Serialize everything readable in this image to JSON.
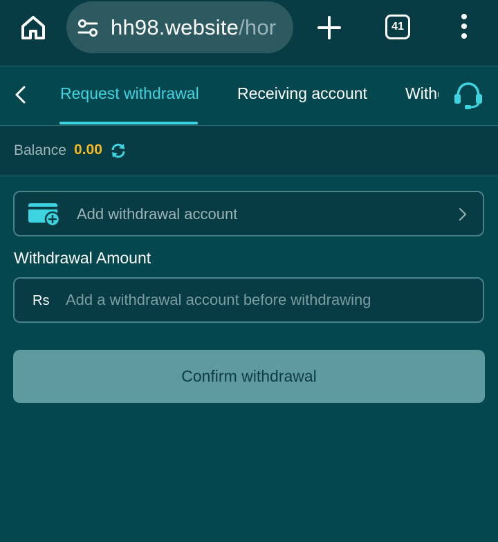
{
  "browser": {
    "url_host": "hh98.website",
    "url_path": "/hor",
    "tab_count": "41"
  },
  "tabs": [
    {
      "label": "Request withdrawal",
      "active": true
    },
    {
      "label": "Receiving account",
      "active": false
    },
    {
      "label": "Withdrawal",
      "active": false
    }
  ],
  "balance": {
    "label": "Balance",
    "value": "0.00"
  },
  "add_account": {
    "label": "Add withdrawal account"
  },
  "amount": {
    "heading": "Withdrawal Amount",
    "currency": "Rs",
    "placeholder": "Add a withdrawal account before withdrawing"
  },
  "confirm": {
    "label": "Confirm withdrawal"
  },
  "colors": {
    "accent": "#3dd4e0",
    "balance": "#f5b820",
    "background": "#05474f",
    "button": "#5f9a9e"
  },
  "icons": {
    "home": "home-icon",
    "site_settings": "tune-icon",
    "new_tab": "plus-icon",
    "menu": "more-vertical-icon",
    "back": "chevron-left-icon",
    "support": "headset-icon",
    "refresh": "refresh-icon",
    "wallet": "wallet-add-icon",
    "chevron": "chevron-right-icon"
  }
}
